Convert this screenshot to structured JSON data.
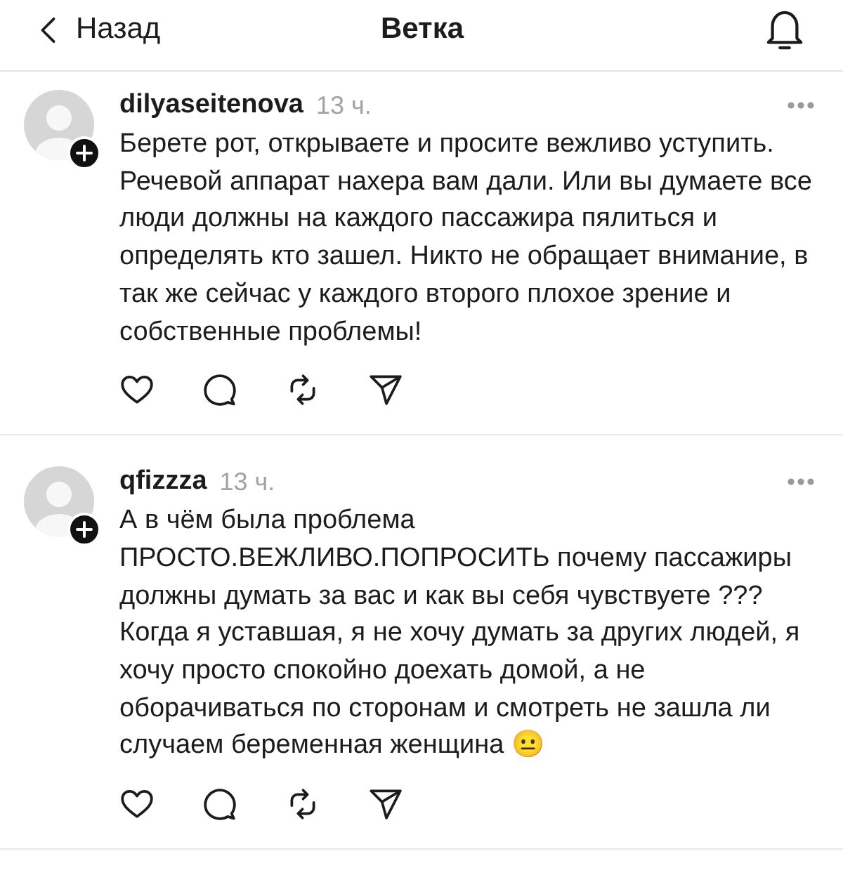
{
  "header": {
    "back_label": "Назад",
    "title": "Ветка"
  },
  "posts": [
    {
      "username": "dilyaseitenova",
      "time": "13 ч.",
      "text": "Берете рот, открываете и просите вежливо уступить. Речевой аппарат нахера вам дали. Или вы думаете все люди должны на каждого пассажира пялиться и определять кто зашел. Никто не обращает внимание, в так же сейчас у каждого второго плохое зрение и собственные проблемы!"
    },
    {
      "username": "qfizzza",
      "time": "13 ч.",
      "text": "А в чём была проблема\nПРОСТО.ВЕЖЛИВО.ПОПРОСИТЬ почему пассажиры должны думать за вас и как вы себя чувствуете ??? Когда я уставшая, я не хочу думать за других людей, я хочу просто спокойно доехать домой, а не оборачиваться по сторонам и смотреть не зашла ли случаем беременная женщина 😐"
    }
  ]
}
